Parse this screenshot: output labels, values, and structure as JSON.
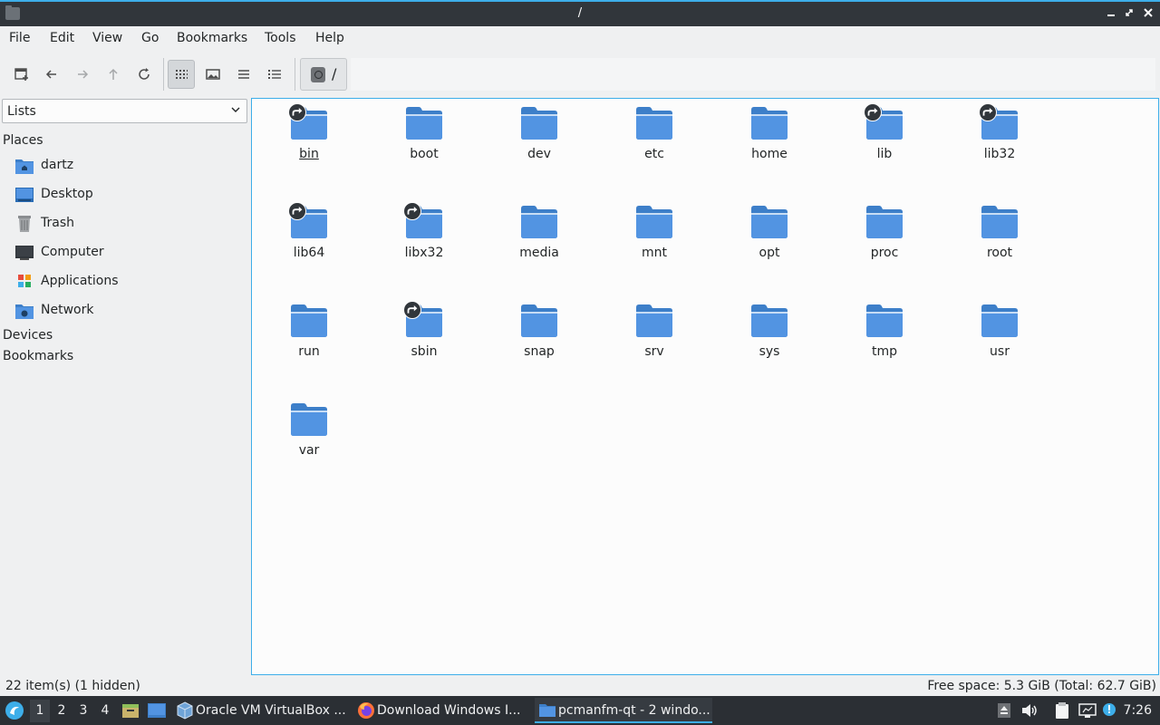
{
  "window": {
    "title": "/"
  },
  "menu": [
    "File",
    "Edit",
    "View",
    "Go",
    "Bookmarks",
    "Tools",
    "Help"
  ],
  "pathbar": {
    "segment": "/"
  },
  "sidepane": {
    "mode": "Lists",
    "places_header": "Places",
    "places": [
      {
        "label": "dartz",
        "icon": "home-folder-icon"
      },
      {
        "label": "Desktop",
        "icon": "desktop-icon"
      },
      {
        "label": "Trash",
        "icon": "trash-icon"
      },
      {
        "label": "Computer",
        "icon": "computer-icon"
      },
      {
        "label": "Applications",
        "icon": "applications-icon"
      },
      {
        "label": "Network",
        "icon": "network-icon"
      }
    ],
    "devices_header": "Devices",
    "bookmarks_header": "Bookmarks"
  },
  "files": [
    {
      "name": "bin",
      "symlink": true
    },
    {
      "name": "boot",
      "symlink": false
    },
    {
      "name": "dev",
      "symlink": false
    },
    {
      "name": "etc",
      "symlink": false
    },
    {
      "name": "home",
      "symlink": false
    },
    {
      "name": "lib",
      "symlink": true
    },
    {
      "name": "lib32",
      "symlink": true
    },
    {
      "name": "lib64",
      "symlink": true
    },
    {
      "name": "libx32",
      "symlink": true
    },
    {
      "name": "media",
      "symlink": false
    },
    {
      "name": "mnt",
      "symlink": false
    },
    {
      "name": "opt",
      "symlink": false
    },
    {
      "name": "proc",
      "symlink": false
    },
    {
      "name": "root",
      "symlink": false
    },
    {
      "name": "run",
      "symlink": false
    },
    {
      "name": "sbin",
      "symlink": true
    },
    {
      "name": "snap",
      "symlink": false
    },
    {
      "name": "srv",
      "symlink": false
    },
    {
      "name": "sys",
      "symlink": false
    },
    {
      "name": "tmp",
      "symlink": false
    },
    {
      "name": "usr",
      "symlink": false
    },
    {
      "name": "var",
      "symlink": false
    }
  ],
  "status": {
    "items": "22 item(s) (1 hidden)",
    "free_space": "Free space: 5.3 GiB (Total: 62.7 GiB)"
  },
  "taskbar": {
    "desktops": [
      "1",
      "2",
      "3",
      "4"
    ],
    "current_desktop": "1",
    "tasks": [
      {
        "label": "Oracle VM VirtualBox ...",
        "icon": "virtualbox-icon"
      },
      {
        "label": "Download Windows I...",
        "icon": "firefox-icon"
      },
      {
        "label": "pcmanfm-qt - 2 windo...",
        "icon": "folder-icon"
      }
    ],
    "clock": "7:26"
  },
  "colors": {
    "accent": "#3daee9",
    "folder": "#5294e2",
    "titlebar": "#31363b",
    "taskbar": "#2b2f34"
  }
}
